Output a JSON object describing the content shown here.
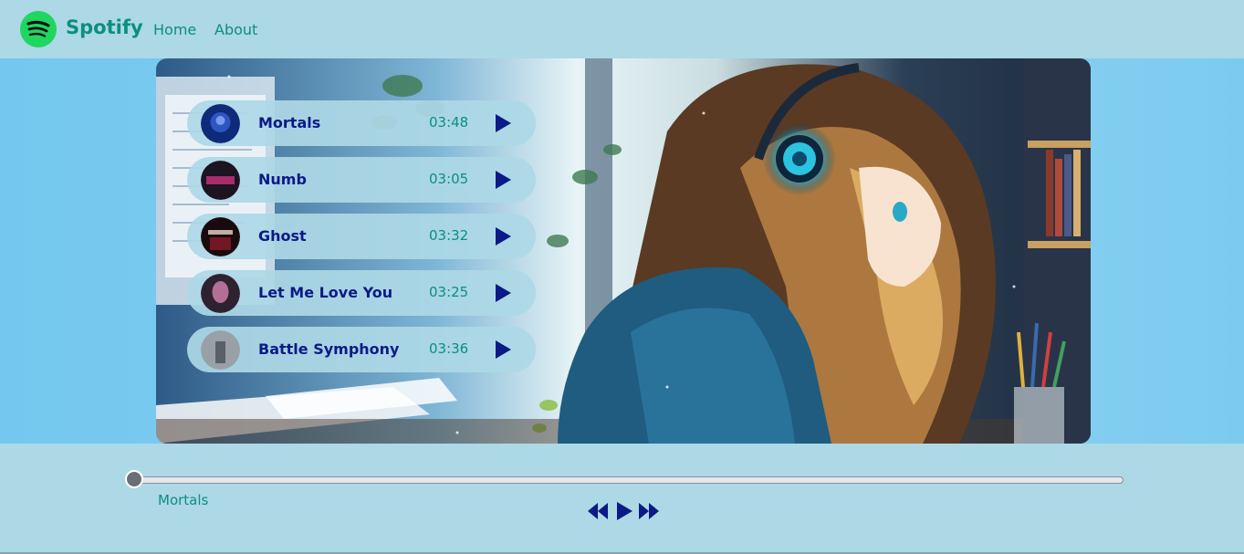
{
  "nav": {
    "brand": "Spotify",
    "links": [
      "Home",
      "About"
    ]
  },
  "songs": [
    {
      "title": "Mortals",
      "duration": "03:48",
      "cover_color": "#1b3a8c"
    },
    {
      "title": "Numb",
      "duration": "03:05",
      "cover_color": "#2a1a2e"
    },
    {
      "title": "Ghost",
      "duration": "03:32",
      "cover_color": "#2a0a12"
    },
    {
      "title": "Let Me Love You",
      "duration": "03:25",
      "cover_color": "#3a2a3e"
    },
    {
      "title": "Battle Symphony",
      "duration": "03:36",
      "cover_color": "#8a9098"
    }
  ],
  "player": {
    "now_playing": "Mortals",
    "progress": 0.0
  },
  "colors": {
    "nav_bg": "#add8e6",
    "accent": "#0b8f7e",
    "song_title": "#0b1a86",
    "logo_green": "#1ed760"
  },
  "icons": {
    "logo": "spotify-logo-icon",
    "play": "play-icon",
    "prev": "previous-icon",
    "next": "next-icon"
  }
}
